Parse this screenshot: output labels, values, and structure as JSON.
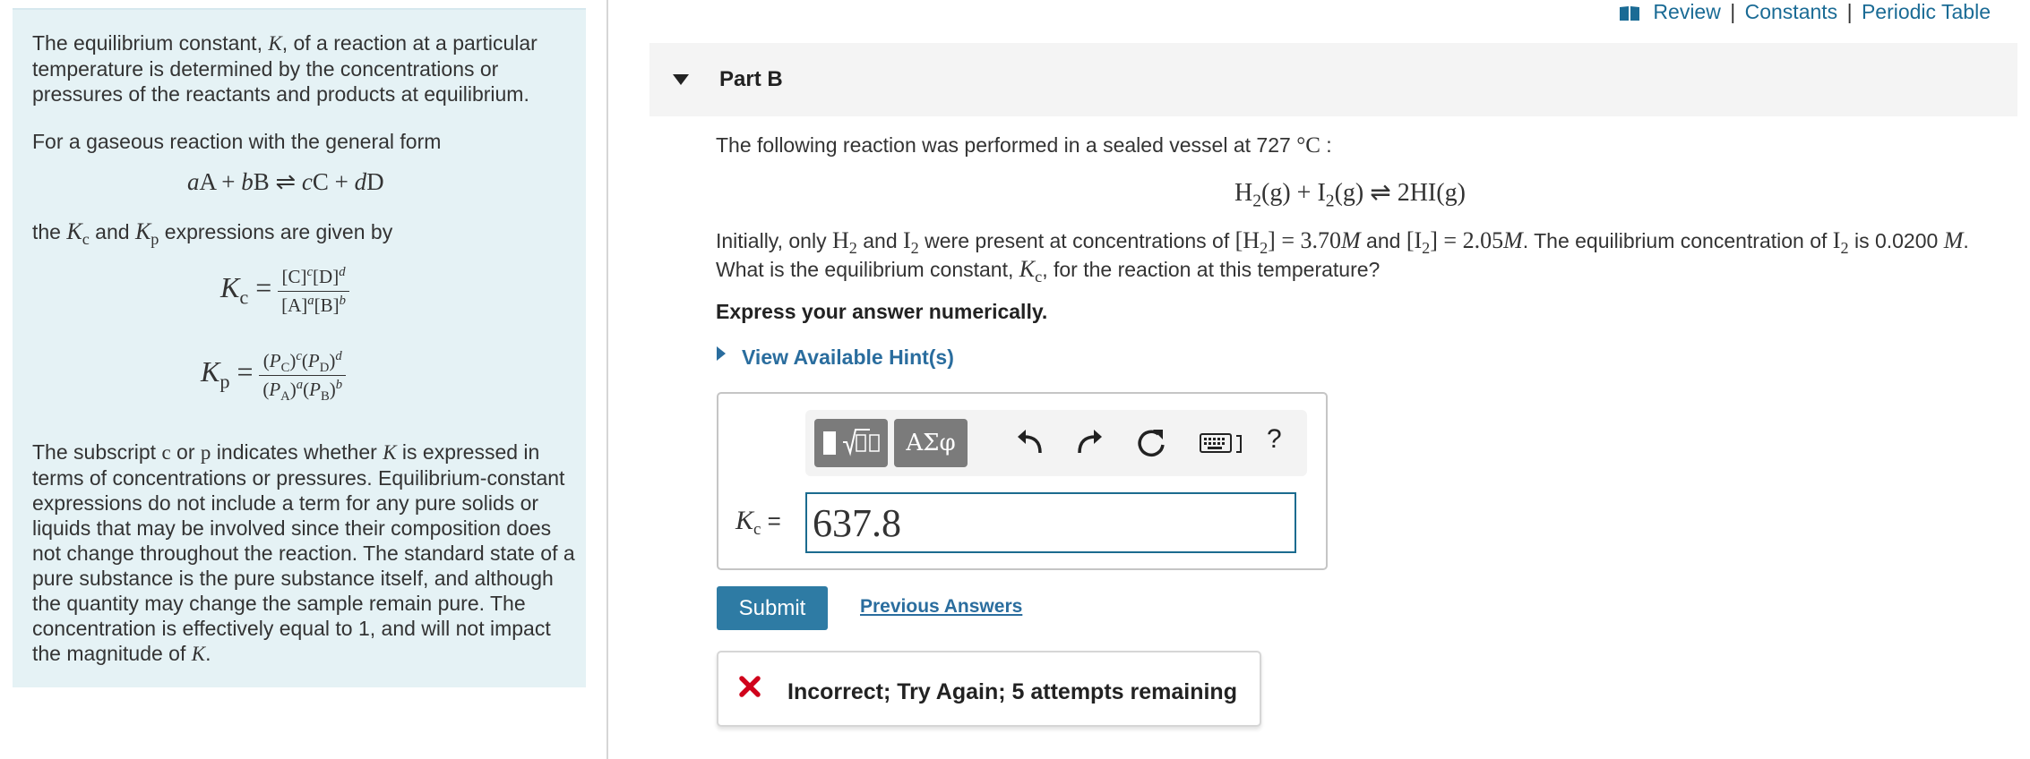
{
  "header": {
    "links": [
      "Review",
      "Constants",
      "Periodic Table"
    ],
    "separator": "|"
  },
  "left": {
    "intro_1": "The equilibrium constant, ",
    "intro_K": "K",
    "intro_2": ", of a reaction at a particular temperature is determined by the concentrations or pressures of the reactants and products at equilibrium.",
    "general_form_text": "For a gaseous reaction with the general form",
    "general_equation": "aA + bB ⇌ cC + dD",
    "expr_text_1": "the ",
    "expr_text_and": " and ",
    "expr_text_2": " expressions are given by",
    "kc_formula_num": "[C]c[D]d",
    "kc_formula_den": "[A]a[B]b",
    "kp_formula_num": "(PC)c(PD)d",
    "kp_formula_den": "(PA)a(PB)b",
    "para_1": "The subscript ",
    "para_c": "c",
    "para_or": " or ",
    "para_p": "p",
    "para_2": " indicates whether ",
    "para_K": "K",
    "para_3": " is expressed in terms of concentrations or pressures. Equilibrium-constant expressions do not include a term for any pure solids or liquids that may be involved since their composition does not change throughout the reaction. The standard state of a pure substance is the pure substance itself, and although the quantity may change the sample remain pure. The concentration is effectively equal to 1, and will not impact the magnitude of ",
    "para_K2": "K",
    "para_end": "."
  },
  "part": {
    "title": "Part B"
  },
  "question": {
    "line1": "The following reaction was performed in a sealed vessel at 727 ",
    "line1_unit": "°C",
    "line1_colon": " :",
    "reaction": "H2(g) + I2(g) ⇌ 2HI(g)",
    "initial_1": "Initially, only ",
    "initial_and": " and ",
    "initial_2": " were present at concentrations of ",
    "h2_conc": "[H2] = 3.70M",
    "and_word": " and ",
    "i2_conc": "[I2] = 2.05M",
    "initial_3": ". The equilibrium concentration of ",
    "initial_4": " is 0.0200 ",
    "unit_M": "M",
    "initial_5": ". What is the equilibrium constant, ",
    "initial_6": ", for the reaction at this temperature?",
    "instruction": "Express your answer numerically.",
    "hint_link": "View Available Hint(s)"
  },
  "answer": {
    "label": "Kc =",
    "value": "637.8",
    "greek_button": "ΑΣφ",
    "help_button": "?"
  },
  "actions": {
    "submit": "Submit",
    "previous_answers": "Previous Answers"
  },
  "feedback": {
    "text": "Incorrect; Try Again; 5 attempts remaining",
    "color": "#d0021b"
  },
  "colors": {
    "link": "#1a6b95",
    "panel_bg": "#e5f2f5",
    "submit_bg": "#2e7ba4",
    "input_border": "#1b6b8f"
  }
}
